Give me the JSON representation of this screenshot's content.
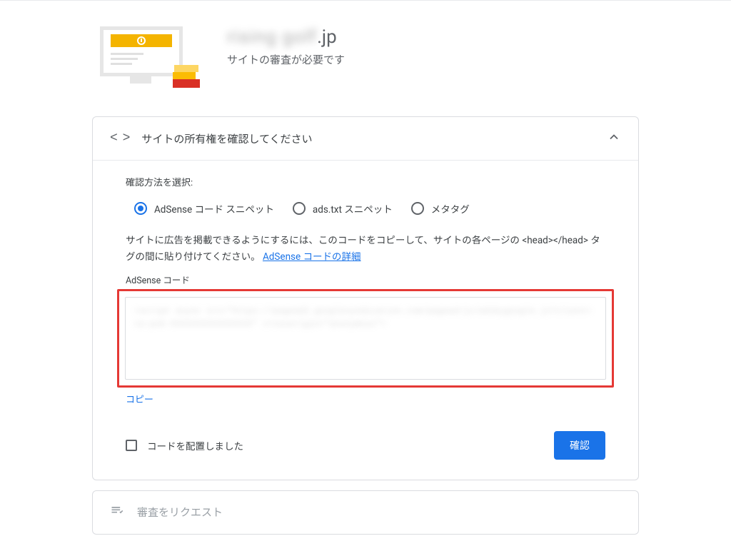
{
  "header": {
    "site_domain_blurred": "rising golf",
    "site_domain_suffix": ".jp",
    "subtitle": "サイトの審査が必要です"
  },
  "ownership_card": {
    "title": "サイトの所有権を確認してください",
    "method_label": "確認方法を選択:",
    "options": {
      "adsense_snippet": "AdSense コード スニペット",
      "ads_txt_snippet": "ads.txt スニペット",
      "meta_tag": "メタタグ"
    },
    "instruction_pre": "サイトに広告を掲載できるようにするには、このコードをコピーして、サイトの各ページの <head></head> タグの間に貼り付けてください。",
    "instruction_link": "AdSense コードの詳細",
    "code_field_label": "AdSense コード",
    "code_blurred_text": "<script async src=\"https://pagead2.googlesyndication.com/pagead/js/adsbygoogle.js?client=ca-pub-XXXXXXXXXXXXXXXX\" crossorigin=\"anonymous\">",
    "copy_label": "コピー",
    "checkbox_label": "コードを配置しました",
    "confirm_button": "確認"
  },
  "review_card": {
    "title": "審査をリクエスト"
  }
}
